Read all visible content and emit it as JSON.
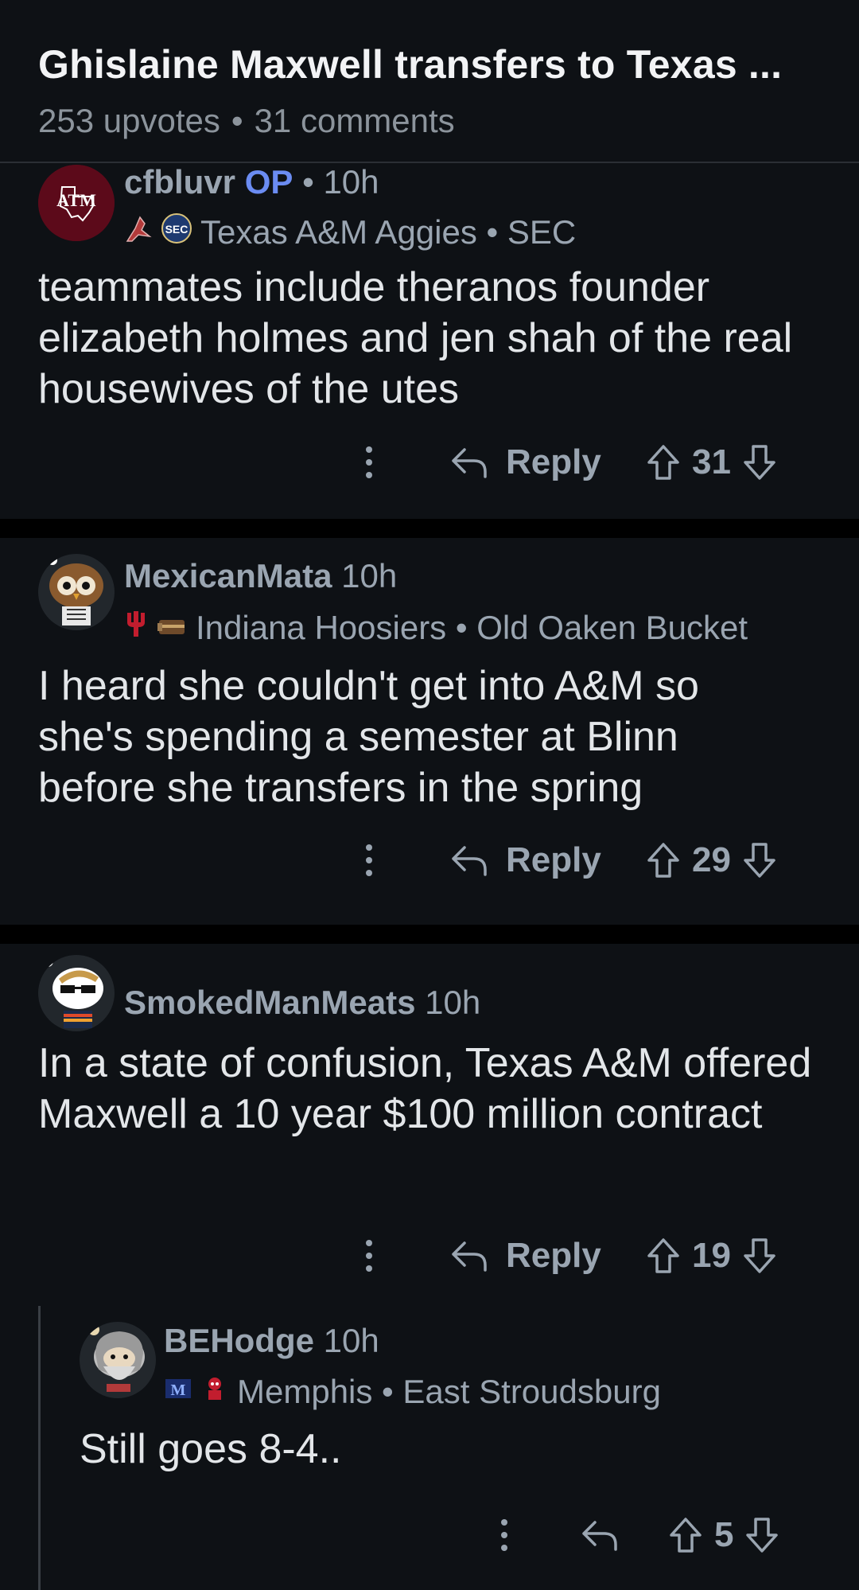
{
  "post": {
    "title": "Ghislaine Maxwell transfers to Texas ...",
    "upvotes": "253 upvotes",
    "separator": "•",
    "comments": "31 comments"
  },
  "comments": [
    {
      "username": "cfbluvr",
      "op_badge": "OP",
      "dot": "•",
      "time": "10h",
      "flair": "Texas A&M Aggies • SEC",
      "body": "teammates include theranos founder elizabeth holmes and jen shah of the real housewives of the utes",
      "reply_label": "Reply",
      "score": "31"
    },
    {
      "username": "MexicanMata",
      "time": "10h",
      "flair": "Indiana Hoosiers • Old Oaken Bucket",
      "body": "I heard she couldn't get into A&M so she's spending a semester at Blinn before she transfers in the spring",
      "reply_label": "Reply",
      "score": "29"
    },
    {
      "username": "SmokedManMeats",
      "time": "10h",
      "body": "In a state of confusion, Texas A&M offered Maxwell a 10 year $100 million contract",
      "reply_label": "Reply",
      "score": "19"
    },
    {
      "username": "BEHodge",
      "time": "10h",
      "flair": "Memphis • East Stroudsburg",
      "body": "Still goes 8-4..",
      "score": "5"
    }
  ],
  "icons": {
    "more": "more-vertical-icon",
    "reply": "reply-arrow-icon",
    "upvote": "upvote-arrow-icon",
    "downvote": "downvote-arrow-icon"
  },
  "colors": {
    "background": "#0e1115",
    "op_badge": "#6b8cf2",
    "muted_text": "#9aa5b1",
    "atm_maroon": "#5c0a1a"
  }
}
